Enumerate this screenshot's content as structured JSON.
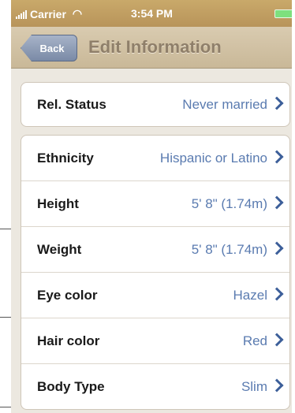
{
  "status_bar": {
    "carrier": "Carrier",
    "time": "3:54 PM"
  },
  "nav": {
    "back_label": "Back",
    "title": "Edit Information"
  },
  "groups": [
    {
      "rows": [
        {
          "label": "Rel. Status",
          "value": "Never married"
        }
      ]
    },
    {
      "rows": [
        {
          "label": "Ethnicity",
          "value": "Hispanic or Latino"
        },
        {
          "label": "Height",
          "value": "5' 8\" (1.74m)"
        },
        {
          "label": "Weight",
          "value": "5' 8\" (1.74m)"
        },
        {
          "label": "Eye color",
          "value": "Hazel"
        },
        {
          "label": "Hair color",
          "value": "Red"
        },
        {
          "label": "Body Type",
          "value": "Slim"
        }
      ]
    }
  ],
  "colors": {
    "nav_bar": "#d9cbb0",
    "back_button": "#7a8aa6",
    "value_text": "#5a7bb0",
    "background": "#ece8e0"
  }
}
